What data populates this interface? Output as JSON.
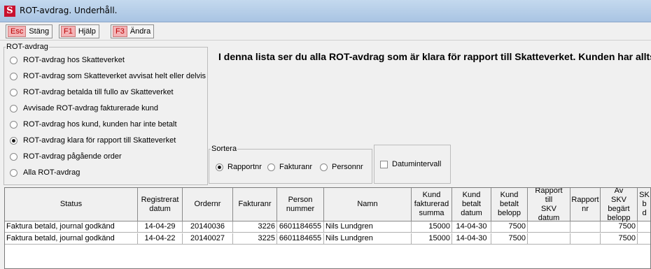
{
  "window": {
    "title": "ROT-avdrag. Underhåll.",
    "app_icon_letter": "S"
  },
  "toolbar": {
    "buttons": [
      {
        "key": "Esc",
        "label": "Stäng"
      },
      {
        "key": "F1",
        "label": "Hjälp"
      },
      {
        "key": "F3",
        "label": "Ändra"
      }
    ]
  },
  "rot_filter": {
    "legend": "ROT-avdrag",
    "options": [
      {
        "label": "ROT-avdrag hos Skatteverket",
        "selected": false
      },
      {
        "label": "ROT-avdrag som Skatteverket avvisat helt eller delvis",
        "selected": false
      },
      {
        "label": "ROT-avdrag betalda till fullo av Skatteverket",
        "selected": false
      },
      {
        "label": "Avvisade ROT-avdrag fakturerade kund",
        "selected": false
      },
      {
        "label": "ROT-avdrag hos kund, kunden har inte betalt",
        "selected": false
      },
      {
        "label": "ROT-avdrag klara för rapport till Skatteverket",
        "selected": true
      },
      {
        "label": "ROT-avdrag pågående order",
        "selected": false
      },
      {
        "label": "Alla ROT-avdrag",
        "selected": false
      }
    ]
  },
  "info_text": "I denna lista ser du alla ROT-avdrag som är klara för rapport till Skatteverket. Kunden har alltså s",
  "sort": {
    "legend": "Sortera",
    "options": [
      {
        "label": "Rapportnr",
        "selected": true
      },
      {
        "label": "Fakturanr",
        "selected": false
      },
      {
        "label": "Personnr",
        "selected": false
      }
    ]
  },
  "date_interval": {
    "label": "Datumintervall",
    "checked": false
  },
  "table": {
    "headers": [
      "Status",
      "Registrerat datum",
      "Ordernr",
      "Fakturanr",
      "Person nummer",
      "Namn",
      "Kund fakturerad summa",
      "Kund betalt datum",
      "Kund betalt belopp",
      "Rapport till SKV datum",
      "Rapport nr",
      "Av SKV begärt belopp",
      "SK b d"
    ],
    "rows": [
      [
        "Faktura betald, journal godkänd",
        "14-04-29",
        "20140036",
        "3226",
        "6601184655",
        "Nils Lundgren",
        "15000",
        "14-04-30",
        "7500",
        "",
        "",
        "7500",
        ""
      ],
      [
        "Faktura betald, journal godkänd",
        "14-04-22",
        "20140027",
        "3225",
        "6601184655",
        "Nils Lundgren",
        "15000",
        "14-04-30",
        "7500",
        "",
        "",
        "7500",
        ""
      ]
    ]
  },
  "colors": {
    "key_bg": "#f3b3b6",
    "title_bg": "#b9d1ea",
    "icon_red": "#c8102e"
  }
}
